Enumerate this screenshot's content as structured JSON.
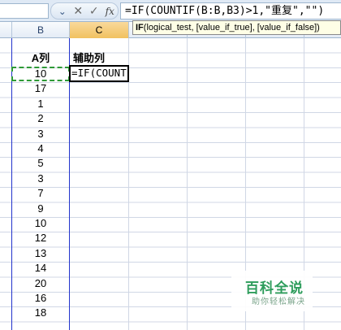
{
  "formula_bar": {
    "cancel_icon": "x-icon",
    "enter_icon": "check-icon",
    "function_icon": "fx",
    "formula": "=IF(COUNTIF(B:B,B3)>1,\"重复\",\"\")"
  },
  "columns": [
    {
      "label": "B",
      "selected": false
    },
    {
      "label": "C",
      "selected": true
    }
  ],
  "tooltip": {
    "function_name": "IF",
    "args": "(logical_test, [value_if_true], [value_if_false])"
  },
  "headers": {
    "col_b": "A列",
    "col_c": "辅助列"
  },
  "editing_text": "=IF(COUNT",
  "values": [
    10,
    17,
    1,
    2,
    3,
    4,
    5,
    3,
    7,
    9,
    10,
    12,
    13,
    14,
    20,
    16,
    18
  ],
  "watermark": {
    "title": "百科全说",
    "subtitle": "助你轻松解决"
  },
  "colors": {
    "selected_header": "#f1c15f",
    "copy_marquee": "#2e9a36",
    "column_bounds": "#2233cc",
    "watermark": "#2e9d5c"
  }
}
